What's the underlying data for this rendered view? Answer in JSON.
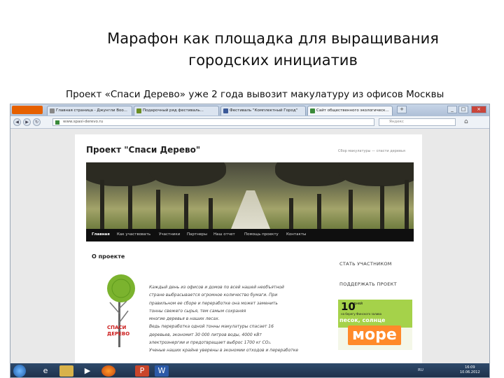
{
  "slide": {
    "title_line1": "Марафон как площадка для выращивания",
    "title_line2": "городских инициатив",
    "subtitle": "Проект «Спаси Дерево» уже 2 года вывозит макулатуру из офисов Москвы"
  },
  "browser": {
    "tabs": [
      {
        "label": "Главная страница - Джунгли Boo...",
        "icon": "wiki-icon",
        "color": "#888888"
      },
      {
        "label": "Подарочный ряд фестиваль...",
        "icon": "doc-icon",
        "color": "#6b8e23"
      },
      {
        "label": "Фестиваль \"Комплектный Город\"",
        "icon": "facebook-icon",
        "color": "#3b5998"
      },
      {
        "label": "Сайт общественного экологическ...",
        "icon": "leaf-icon",
        "color": "#3a8a3a"
      }
    ],
    "url": "www.spasi-derevo.ru",
    "search_placeholder": "Яндекс"
  },
  "site": {
    "title": "Проект \"Спаси Дерево\"",
    "tagline": "Сбор макулатуры — спасти деревья",
    "menu": [
      "Главная",
      "Как участвовать",
      "Участники",
      "Партнеры",
      "Наш отчет",
      "Помощь проекту",
      "Контакты"
    ],
    "about_heading": "О проекте",
    "logo_text_line1": "СПАСИ",
    "logo_text_line2": "ДЕРЕВО",
    "about_lines": [
      "Каждый день из офисов и домов по всей нашей необъятной",
      "стране выбрасывается огромное количество бумаги. При",
      "правильном ее сборе и переработке она может заменить",
      "тонны свежего сырья, тем самым сохраняя",
      "многие деревья в наших лесах.",
      "Ведь переработка одной тонны макулатуры спасает 16",
      "деревьев, экономит 30 000 литров воды, 4000 кВт",
      "электроэнергии и предотвращает выброс 1700 кг CO₂.",
      "Ученые наших крайне уверены в экономии отходов и переработке"
    ],
    "side_link1": "СТАТЬ УЧАСТНИКОМ",
    "side_link2": "ПОДДЕРЖАТЬ ПРОЕКТ",
    "banner": {
      "num": "10",
      "days": "дней",
      "sub": "на берегу Финского залива",
      "mid": "песок, солнце",
      "big": "море"
    }
  },
  "taskbar": {
    "lang": "RU",
    "time": "16:09",
    "date": "10.06.2012"
  }
}
